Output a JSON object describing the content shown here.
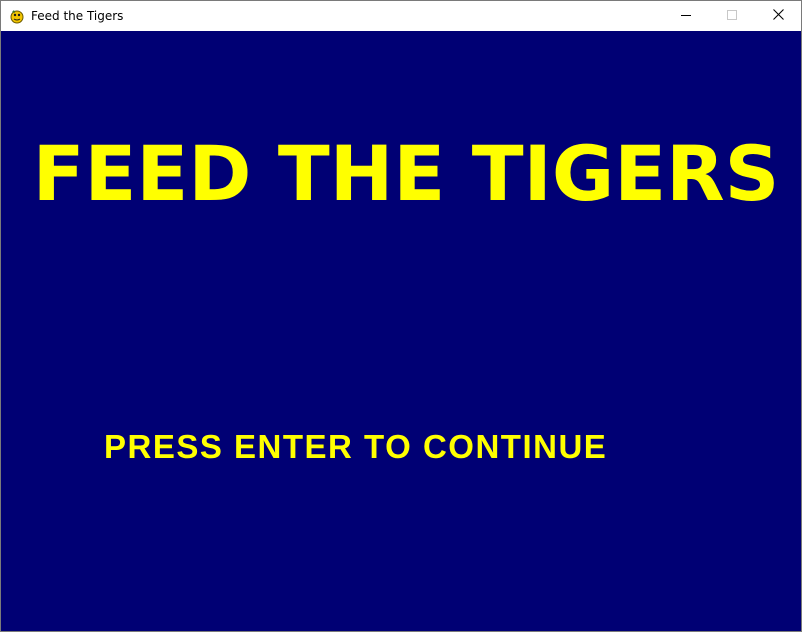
{
  "window": {
    "title": "Feed the Tigers",
    "icon": "pygame-snake-icon"
  },
  "caption_buttons": {
    "minimize": "minimize-icon",
    "maximize": "maximize-icon",
    "close": "close-icon"
  },
  "game": {
    "background_color": "#000074",
    "text_color": "#ffff00",
    "title": "FEED THE TIGERS",
    "prompt": "PRESS ENTER TO CONTINUE"
  }
}
